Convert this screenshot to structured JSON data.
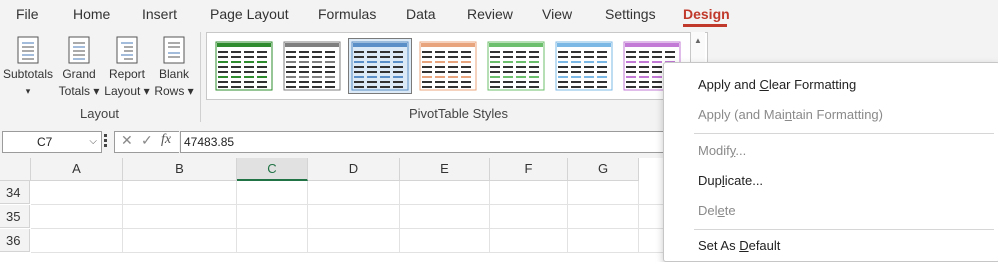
{
  "menu": {
    "tabs": [
      "File",
      "Home",
      "Insert",
      "Page Layout",
      "Formulas",
      "Data",
      "Review",
      "View",
      "Settings",
      "Design"
    ],
    "active_tab": "Design"
  },
  "ribbon": {
    "layout_group": {
      "label": "Layout",
      "buttons": [
        {
          "line1": "Subtotals",
          "line2": "▾"
        },
        {
          "line1": "Grand",
          "line2": "Totals ▾"
        },
        {
          "line1": "Report",
          "line2": "Layout ▾"
        },
        {
          "line1": "Blank",
          "line2": "Rows ▾"
        }
      ]
    },
    "styles_group": {
      "label": "PivotTable Styles",
      "thumb_colors": [
        "#2e8b2e",
        "#7f7f7f",
        "#5b8fc7",
        "#e8a47c",
        "#6cbf6c",
        "#7cb8e6",
        "#c27ad6"
      ]
    }
  },
  "formula_bar": {
    "name_box": "C7",
    "fx_label": "fx",
    "value": "47483.85"
  },
  "grid": {
    "columns": [
      "A",
      "B",
      "C",
      "D",
      "E",
      "F",
      "G"
    ],
    "selected_column": "C",
    "rows": [
      "34",
      "35",
      "36"
    ]
  },
  "context_menu": {
    "items": [
      {
        "label": "Apply and Clear Formatting",
        "enabled": true
      },
      {
        "label": "Apply (and Maintain Formatting)",
        "enabled": false
      },
      {
        "label": "Modify...",
        "enabled": false
      },
      {
        "label": "Duplicate...",
        "enabled": true
      },
      {
        "label": "Delete",
        "enabled": false
      },
      {
        "label": "Set As Default",
        "enabled": true
      }
    ]
  }
}
